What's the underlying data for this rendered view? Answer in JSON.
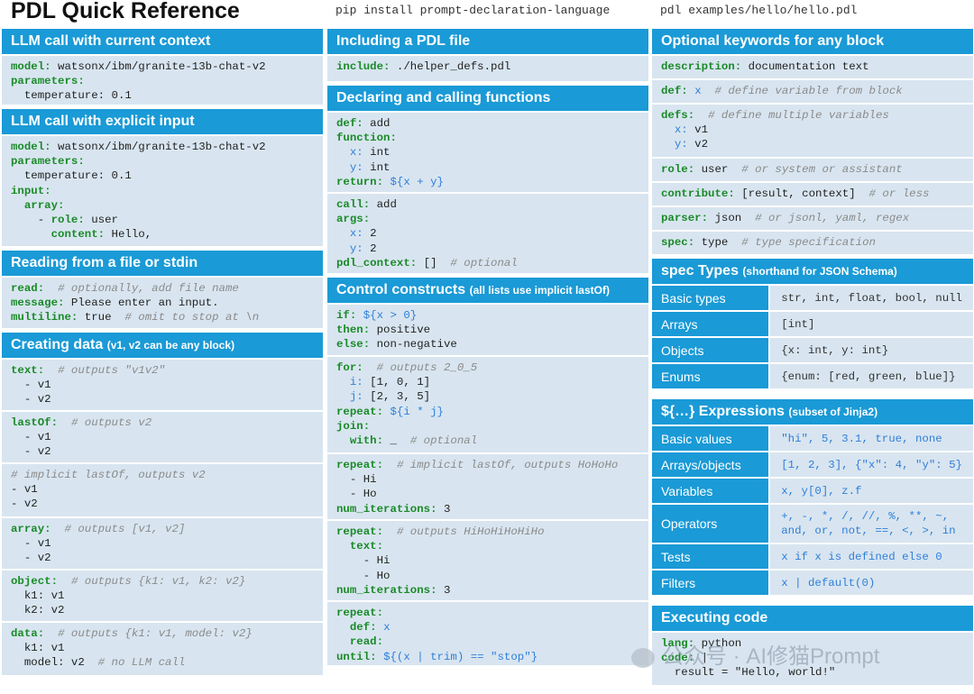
{
  "header": {
    "title": "PDL Quick Reference",
    "install": "pip install prompt-declaration-language",
    "example": "pdl examples/hello/hello.pdl"
  },
  "col1": {
    "llm_context": {
      "title": "LLM call with current context"
    },
    "llm_input": {
      "title": "LLM call with explicit input"
    },
    "reading": {
      "title": "Reading from a file or stdin"
    },
    "creating": {
      "title": "Creating data",
      "subtitle": "(v1, v2 can be any block)"
    }
  },
  "col2": {
    "include": {
      "title": "Including a PDL file"
    },
    "functions": {
      "title": "Declaring and calling functions"
    },
    "control": {
      "title": "Control constructs",
      "subtitle": "(all lists use implicit lastOf)"
    }
  },
  "col3": {
    "optional": {
      "title": "Optional keywords for any block"
    },
    "spec": {
      "title": "spec Types",
      "subtitle": "(shorthand for JSON Schema)",
      "rows": [
        {
          "label": "Basic types",
          "value": "str, int, float, bool, null"
        },
        {
          "label": "Arrays",
          "value": "[int]"
        },
        {
          "label": "Objects",
          "value": "{x: int, y: int}"
        },
        {
          "label": "Enums",
          "value": "{enum: [red, green, blue]}"
        }
      ]
    },
    "expr": {
      "title": "${…} Expressions",
      "subtitle": "(subset of Jinja2)",
      "rows": [
        {
          "label": "Basic values",
          "value": "\"hi\", 5, 3.1, true, none"
        },
        {
          "label": "Arrays/objects",
          "value": "[1, 2, 3], {\"x\": 4, \"y\": 5}"
        },
        {
          "label": "Variables",
          "value": "x, y[0], z.f"
        },
        {
          "label": "Operators",
          "value": "+, -, *, /, //, %, **, ~,\nand, or, not, ==, <, >, in"
        },
        {
          "label": "Tests",
          "value": "x if x is defined else 0"
        },
        {
          "label": "Filters",
          "value": "x | default(0)"
        }
      ]
    },
    "exec": {
      "title": "Executing code"
    }
  },
  "watermark": "公众号 · AI修猫Prompt"
}
